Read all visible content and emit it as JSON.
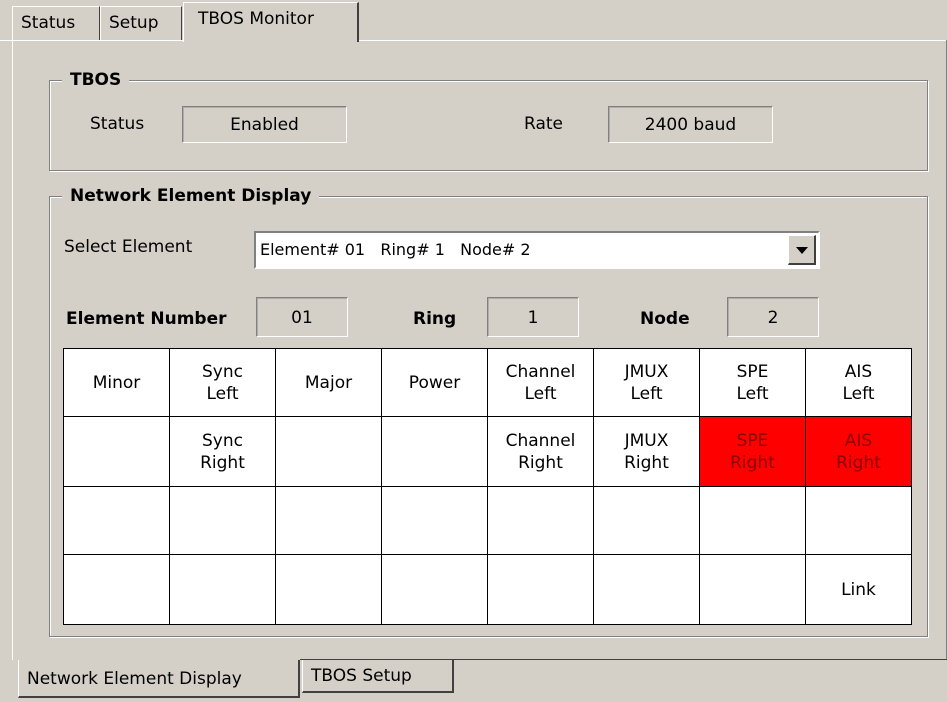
{
  "tabs": [
    {
      "label": "Status"
    },
    {
      "label": "Setup"
    },
    {
      "label": "TBOS Monitor"
    }
  ],
  "tbos": {
    "title": "TBOS",
    "status_label": "Status",
    "status_value": "Enabled",
    "rate_label": "Rate",
    "rate_value": "2400 baud"
  },
  "ned": {
    "title": "Network Element Display",
    "select_label": "Select Element",
    "select_value": "Element# 01   Ring# 1   Node# 2",
    "element_number_label": "Element Number",
    "element_number_value": "01",
    "ring_label": "Ring",
    "ring_value": "1",
    "node_label": "Node",
    "node_value": "2"
  },
  "grid": {
    "alarm_color": "#ff0000",
    "rows": [
      [
        "Minor",
        "Sync\nLeft",
        "Major",
        "Power",
        "Channel\nLeft",
        "JMUX\nLeft",
        "SPE\nLeft",
        "AIS\nLeft"
      ],
      [
        "",
        "Sync\nRight",
        "",
        "",
        "Channel\nRight",
        "JMUX\nRight",
        "SPE\nRight",
        "AIS\nRight"
      ],
      [
        "",
        "",
        "",
        "",
        "",
        "",
        "",
        ""
      ],
      [
        "",
        "",
        "",
        "",
        "",
        "",
        "",
        "Link"
      ]
    ],
    "alarms": [
      [
        1,
        6
      ],
      [
        1,
        7
      ]
    ]
  },
  "bottom_tabs": [
    {
      "label": "Network Element Display"
    },
    {
      "label": "TBOS Setup"
    }
  ]
}
